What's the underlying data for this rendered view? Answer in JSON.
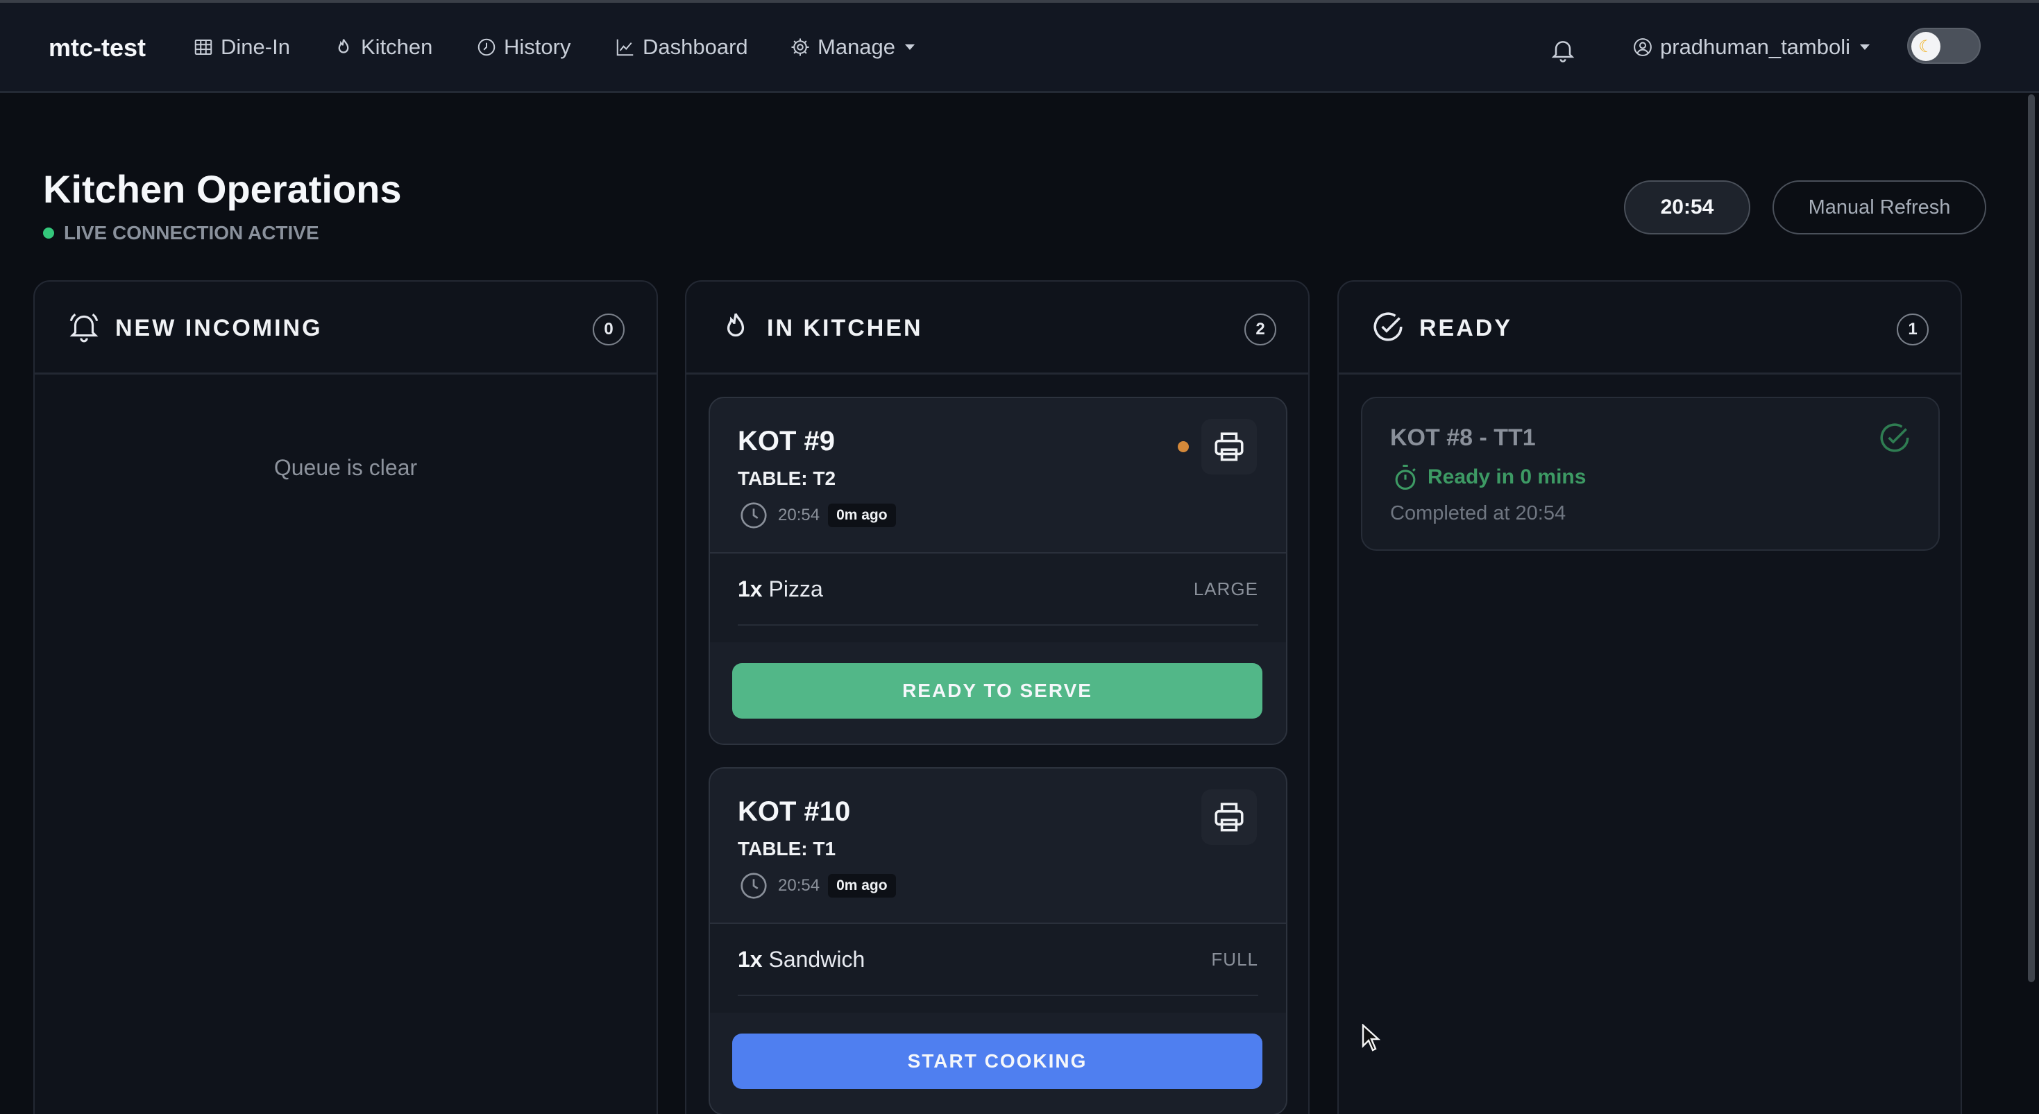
{
  "nav": {
    "brand": "mtc-test",
    "links": [
      {
        "label": "Dine-In",
        "icon": "table-grid-icon"
      },
      {
        "label": "Kitchen",
        "icon": "flame-icon"
      },
      {
        "label": "History",
        "icon": "clock-icon"
      },
      {
        "label": "Dashboard",
        "icon": "chart-line-icon"
      },
      {
        "label": "Manage",
        "icon": "gear-icon"
      }
    ],
    "user": "pradhuman_tamboli",
    "theme_toggle_icon": "moon-icon"
  },
  "header": {
    "title": "Kitchen Operations",
    "live_status": "LIVE CONNECTION ACTIVE",
    "clock": "20:54",
    "refresh_label": "Manual Refresh"
  },
  "columns": {
    "incoming": {
      "title": "NEW INCOMING",
      "count": "0",
      "empty_text": "Queue is clear",
      "icon": "bell-icon"
    },
    "kitchen": {
      "title": "IN KITCHEN",
      "count": "2",
      "icon": "flame-icon"
    },
    "ready": {
      "title": "READY",
      "count": "1",
      "icon": "check-circle-icon"
    }
  },
  "kitchen_orders": [
    {
      "title": "KOT #9",
      "table": "TABLE: T2",
      "time": "20:54",
      "ago": "0m ago",
      "item_qty": "1x",
      "item_name": "Pizza",
      "item_size": "LARGE",
      "action": "READY TO SERVE"
    },
    {
      "title": "KOT #10",
      "table": "TABLE: T1",
      "time": "20:54",
      "ago": "0m ago",
      "item_qty": "1x",
      "item_name": "Sandwich",
      "item_size": "FULL",
      "action": "START COOKING"
    }
  ],
  "ready_orders": [
    {
      "title": "KOT #8 - TT1",
      "status": "Ready in 0 mins",
      "completed": "Completed at 20:54"
    }
  ],
  "colors": {
    "accent_green": "#52b788",
    "accent_blue": "#4f7ff0",
    "live_dot": "#34c77b",
    "pending_dot": "#d4893a"
  }
}
